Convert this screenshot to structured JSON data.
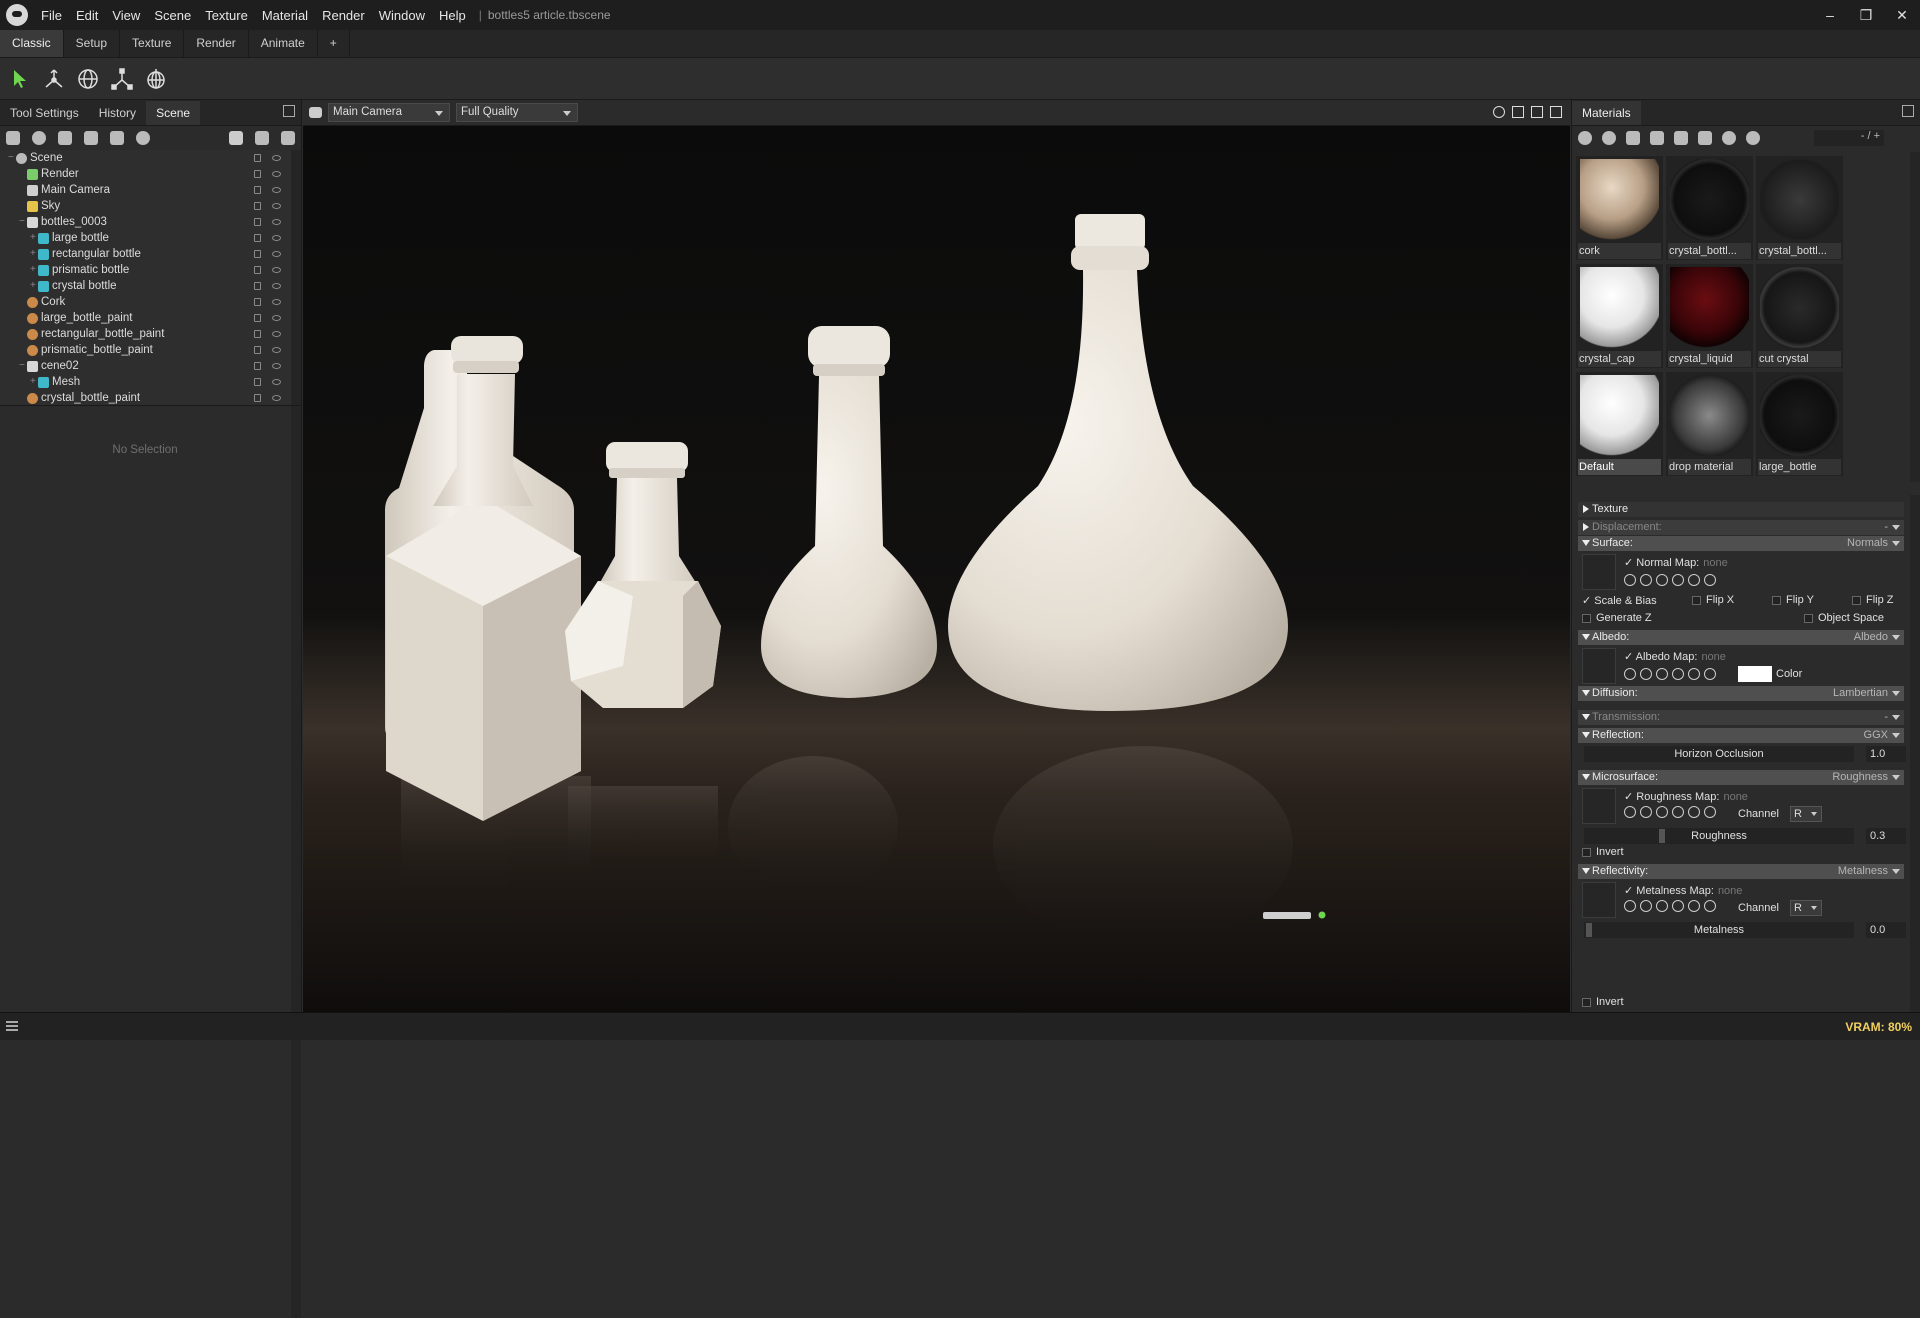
{
  "app": {
    "doc_title": "bottles5 article.tbscene",
    "vram": "VRAM: 80%"
  },
  "menu": [
    "File",
    "Edit",
    "View",
    "Scene",
    "Texture",
    "Material",
    "Render",
    "Window",
    "Help"
  ],
  "workspace_tabs": [
    "Classic",
    "Setup",
    "Texture",
    "Render",
    "Animate",
    "+"
  ],
  "toolbar_icons": [
    "select-arrow-icon",
    "translate-gizmo-icon",
    "rotate-gizmo-icon",
    "scale-gizmo-icon",
    "world-transform-icon"
  ],
  "left_panel": {
    "tabs": [
      "Tool Settings",
      "History",
      "Scene"
    ],
    "active_tab": "Scene",
    "no_selection": "No Selection",
    "tree": [
      {
        "label": "Scene",
        "depth": 0,
        "icon": "scene-icon",
        "color": "#bbbbbb"
      },
      {
        "label": "Render",
        "depth": 1,
        "icon": "render-icon",
        "color": "#7acb6a"
      },
      {
        "label": "Main Camera",
        "depth": 1,
        "icon": "camera-icon",
        "color": "#cfcfcf"
      },
      {
        "label": "Sky",
        "depth": 1,
        "icon": "sky-icon",
        "color": "#e6c44a"
      },
      {
        "label": "bottles_0003",
        "depth": 1,
        "icon": "mesh-file-icon",
        "color": "#d8d8d8"
      },
      {
        "label": "large bottle",
        "depth": 2,
        "icon": "mesh-icon",
        "color": "#3fb8c9"
      },
      {
        "label": "rectangular bottle",
        "depth": 2,
        "icon": "mesh-icon",
        "color": "#3fb8c9"
      },
      {
        "label": "prismatic bottle",
        "depth": 2,
        "icon": "mesh-icon",
        "color": "#3fb8c9"
      },
      {
        "label": "crystal bottle",
        "depth": 2,
        "icon": "mesh-icon",
        "color": "#3fb8c9"
      },
      {
        "label": "Cork",
        "depth": 1,
        "icon": "material-icon",
        "color": "#c98a4a"
      },
      {
        "label": "large_bottle_paint",
        "depth": 1,
        "icon": "material-icon",
        "color": "#c98a4a"
      },
      {
        "label": "rectangular_bottle_paint",
        "depth": 1,
        "icon": "material-icon",
        "color": "#c98a4a"
      },
      {
        "label": "prismatic_bottle_paint",
        "depth": 1,
        "icon": "material-icon",
        "color": "#c98a4a"
      },
      {
        "label": "cene02",
        "depth": 1,
        "icon": "mesh-file-icon",
        "color": "#d8d8d8"
      },
      {
        "label": "Mesh",
        "depth": 2,
        "icon": "mesh-icon",
        "color": "#3fb8c9"
      },
      {
        "label": "crystal_bottle_paint",
        "depth": 1,
        "icon": "material-icon",
        "color": "#c98a4a"
      }
    ]
  },
  "viewport": {
    "camera": "Main Camera",
    "quality": "Full Quality"
  },
  "materials": {
    "title": "Materials",
    "counter": "- / +",
    "items": [
      {
        "name": "cork",
        "style": "cork"
      },
      {
        "name": "crystal_bottl...",
        "style": "glass"
      },
      {
        "name": "crystal_bottl...",
        "style": "sparkle"
      },
      {
        "name": "crystal_cap",
        "style": "white"
      },
      {
        "name": "crystal_liquid",
        "style": "red"
      },
      {
        "name": "cut crystal",
        "style": "glass2"
      },
      {
        "name": "Default",
        "style": "white"
      },
      {
        "name": "drop material",
        "style": "drops"
      },
      {
        "name": "large_bottle",
        "style": "glass"
      }
    ]
  },
  "properties": {
    "texture": "Texture",
    "displacement": {
      "label": "Displacement:",
      "value": "-"
    },
    "surface": {
      "label": "Surface:",
      "value": "Normals",
      "map_label": "Normal Map:",
      "map_value": "none",
      "scale_bias": "Scale & Bias",
      "flip_x": "Flip X",
      "flip_y": "Flip Y",
      "flip_z": "Flip Z",
      "generate_z": "Generate Z",
      "object_space": "Object Space"
    },
    "albedo": {
      "label": "Albedo:",
      "value": "Albedo",
      "map_label": "Albedo Map:",
      "map_value": "none",
      "color_label": "Color"
    },
    "diffusion": {
      "label": "Diffusion:",
      "value": "Lambertian"
    },
    "transmission": {
      "label": "Transmission:",
      "value": "-"
    },
    "reflection": {
      "label": "Reflection:",
      "value": "GGX",
      "horizon_label": "Horizon Occlusion",
      "horizon_value": "1.0"
    },
    "microsurface": {
      "label": "Microsurface:",
      "value": "Roughness",
      "map_label": "Roughness Map:",
      "map_value": "none",
      "channel_label": "Channel",
      "channel": "R",
      "slider_label": "Roughness",
      "slider_value": "0.3",
      "invert": "Invert"
    },
    "reflectivity": {
      "label": "Reflectivity:",
      "value": "Metalness",
      "map_label": "Metalness Map:",
      "map_value": "none",
      "channel_label": "Channel",
      "channel": "R",
      "slider_label": "Metalness",
      "slider_value": "0.0",
      "invert": "Invert"
    }
  }
}
